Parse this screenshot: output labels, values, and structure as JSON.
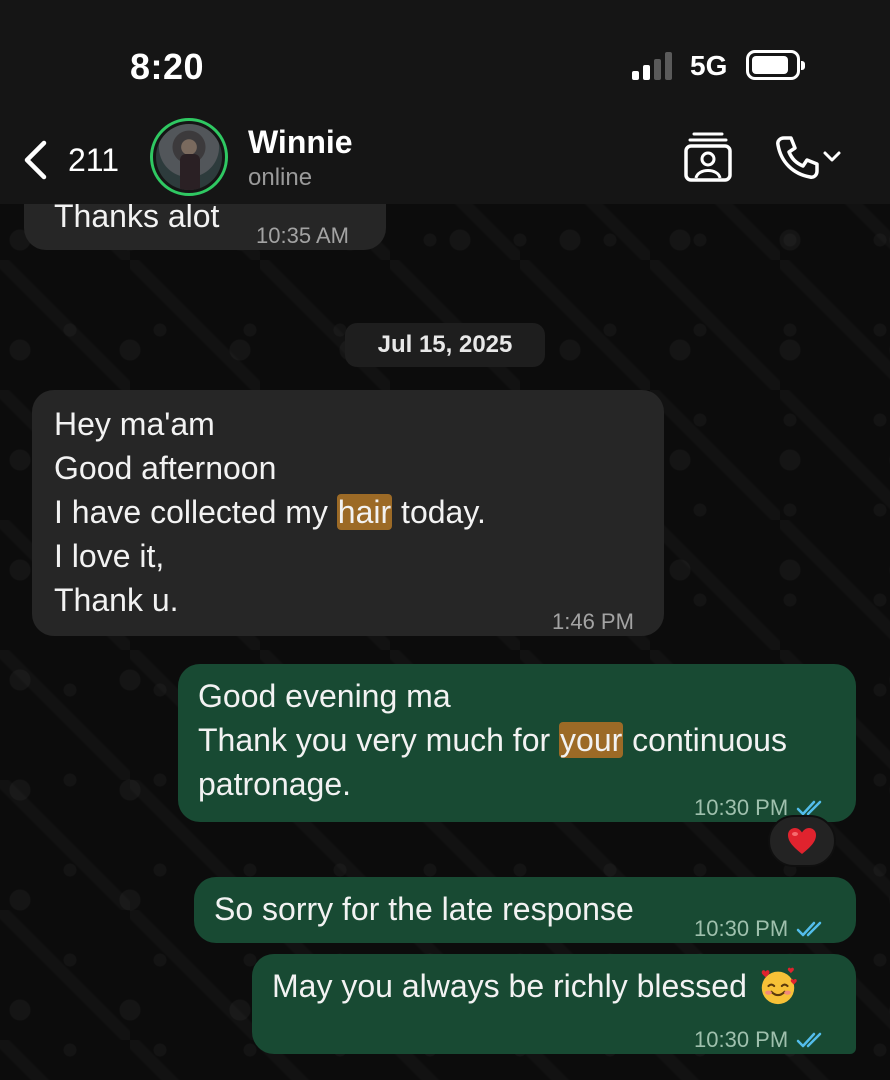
{
  "status_bar": {
    "time": "8:20",
    "network": "5G"
  },
  "header": {
    "back_count": "211",
    "contact_name": "Winnie",
    "contact_status": "online",
    "icons": [
      "chevron-left-icon",
      "video-call-icon",
      "phone-icon",
      "chevron-down-icon"
    ]
  },
  "messages": {
    "prev": {
      "text": "Thanks alot",
      "time": "10:35 AM"
    },
    "date_separator": "Jul 15, 2025",
    "m1": {
      "line1": "Hey ma'am",
      "line2": "Good afternoon",
      "line3_pre": "I have collected my ",
      "line3_hl": "hair",
      "line3_post": " today.",
      "line4": "I love it,",
      "line5": "Thank u.",
      "time": "1:46 PM"
    },
    "m2": {
      "line1": "Good evening ma",
      "line2_pre": "Thank you very much for ",
      "line2_hl": "your",
      "line2_post": " continuous",
      "line3": "patronage.",
      "time": "10:30 PM",
      "reaction": "heart"
    },
    "m3": {
      "text": "So sorry for the late response",
      "time": "10:30 PM"
    },
    "m4": {
      "text": "May you always be richly blessed",
      "emoji": "smiling-face-with-hearts",
      "time": "10:30 PM"
    }
  },
  "colors": {
    "incoming_bubble": "#262626",
    "outgoing_bubble": "#184a33",
    "highlight": "#9c6a26",
    "read_ticks": "#53bdeb",
    "avatar_ring": "#2fc862"
  }
}
